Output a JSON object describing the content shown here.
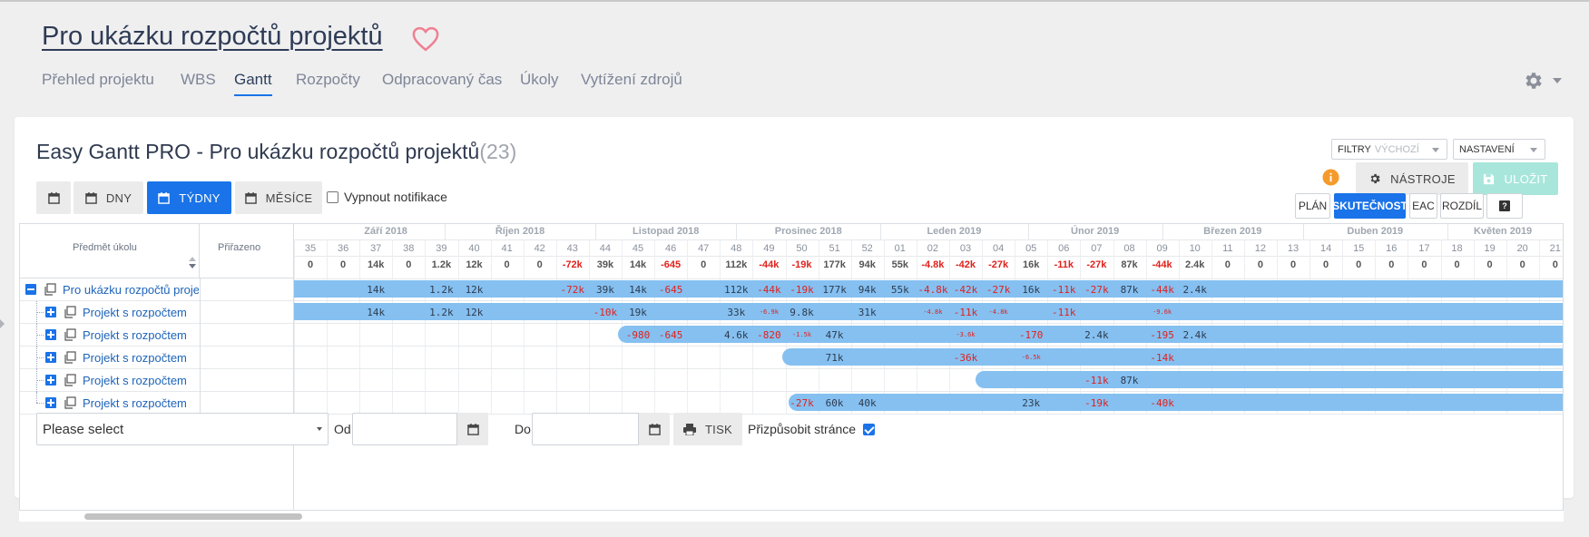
{
  "header": {
    "project_title": "Pro ukázku rozpočtů projektů",
    "tabs": [
      {
        "label": "Přehled projektu"
      },
      {
        "label": "WBS"
      },
      {
        "label": "Gantt"
      },
      {
        "label": "Rozpočty"
      },
      {
        "label": "Odpracovaný čas"
      },
      {
        "label": "Úkoly"
      },
      {
        "label": "Vytížení zdrojů"
      }
    ],
    "active_tab": "Gantt"
  },
  "gantt": {
    "title": "Easy Gantt PRO - Pro ukázku rozpočtů projektů",
    "count": "(23)",
    "filters": {
      "label": "FILTRY",
      "value": "VÝCHOZÍ"
    },
    "settings_label": "NASTAVENÍ",
    "zoom_buttons": {
      "days": "DNY",
      "weeks": "TÝDNY",
      "months": "MĚSÍCE",
      "active": "TÝDNY"
    },
    "notifications_label": "Vypnout notifikace",
    "notifications_checked": false,
    "tools_label": "NÁSTROJE",
    "save_label": "ULOŽIT",
    "modes": [
      "PLÁN",
      "SKUTEČNOST",
      "EAC",
      "ROZDÍL",
      "?"
    ],
    "active_mode": "SKUTEČNOST",
    "columns": {
      "subject": "Předmět úkolu",
      "assigned": "Přiřazeno"
    },
    "months": [
      {
        "label": "Září 2018"
      },
      {
        "label": "Říjen 2018"
      },
      {
        "label": "Listopad 2018"
      },
      {
        "label": "Prosinec 2018"
      },
      {
        "label": "Leden 2019"
      },
      {
        "label": "Únor 2019"
      },
      {
        "label": "Březen 2019"
      },
      {
        "label": "Duben 2019"
      },
      {
        "label": "Květen 2019"
      }
    ],
    "weeks": [
      "35",
      "36",
      "37",
      "38",
      "39",
      "40",
      "41",
      "42",
      "43",
      "44",
      "45",
      "46",
      "47",
      "48",
      "49",
      "50",
      "51",
      "52",
      "01",
      "02",
      "03",
      "04",
      "05",
      "06",
      "07",
      "08",
      "09",
      "10",
      "11",
      "12",
      "13",
      "14",
      "15",
      "16",
      "17",
      "18",
      "19",
      "20",
      "21"
    ],
    "totals": [
      "0",
      "0",
      "14k",
      "0",
      "1.2k",
      "12k",
      "0",
      "0",
      "-72k",
      "39k",
      "14k",
      "-645",
      "0",
      "112k",
      "-44k",
      "-19k",
      "177k",
      "94k",
      "55k",
      "-4.8k",
      "-42k",
      "-27k",
      "16k",
      "-11k",
      "-27k",
      "87k",
      "-44k",
      "2.4k",
      "0",
      "0",
      "0",
      "0",
      "0",
      "0",
      "0",
      "0",
      "0",
      "0",
      "0"
    ],
    "rows": [
      {
        "name": "Pro ukázku rozpočtů projektů",
        "level": 0,
        "expanded": true,
        "bar_start_week": 0,
        "values": {
          "2": "14k",
          "4": "1.2k",
          "5": "12k",
          "8": "-72k",
          "9": "39k",
          "10": "14k",
          "11": "-645",
          "13": "112k",
          "14": "-44k",
          "15": "-19k",
          "16": "177k",
          "17": "94k",
          "18": "55k",
          "19": "-4.8k",
          "20": "-42k",
          "21": "-27k",
          "22": "16k",
          "23": "-11k",
          "24": "-27k",
          "25": "87k",
          "26": "-44k",
          "27": "2.4k"
        }
      },
      {
        "name": "Projekt s rozpočtem",
        "level": 1,
        "expanded": false,
        "bar_start_week": 0,
        "values": {
          "2": "14k",
          "4": "1.2k",
          "5": "12k",
          "9": "-10k",
          "10": "19k",
          "13": "33k",
          "14": "-6.9k",
          "15": "9.8k",
          "17": "31k",
          "19": "-4.8k",
          "20": "-11k",
          "21": "-4.8k",
          "23": "-11k",
          "26": "-9.6k"
        }
      },
      {
        "name": "Projekt s rozpočtem",
        "level": 1,
        "expanded": false,
        "bar_start_week": 9.9,
        "values": {
          "10": "-980",
          "11": "-645",
          "13": "4.6k",
          "14": "-820",
          "15": "-1.5k",
          "16": "47k",
          "20": "-3.6k",
          "22": "-170",
          "24": "2.4k",
          "26": "-195",
          "27": "2.4k"
        }
      },
      {
        "name": "Projekt s rozpočtem",
        "level": 1,
        "expanded": false,
        "bar_start_week": 14.9,
        "values": {
          "16": "71k",
          "20": "-36k",
          "22": "-6.5k",
          "26": "-14k"
        }
      },
      {
        "name": "Projekt s rozpočtem",
        "level": 1,
        "expanded": false,
        "bar_start_week": 20.8,
        "values": {
          "24": "-11k",
          "25": "87k"
        }
      },
      {
        "name": "Projekt s rozpočtem",
        "level": 1,
        "expanded": false,
        "bar_start_week": 15.1,
        "values": {
          "15": "-27k",
          "16": "60k",
          "17": "40k",
          "22": "23k",
          "24": "-19k",
          "26": "-40k"
        }
      }
    ]
  },
  "footer": {
    "select_placeholder": "Please select",
    "from_label": "Od",
    "to_label": "Do",
    "from_value": "",
    "to_value": "",
    "print_label": "TISK",
    "fit_label": "Přizpůsobit stránce",
    "fit_checked": true
  },
  "colors": {
    "accent": "#1a73e8",
    "bar": "#85c0f1",
    "negative": "#e0211d",
    "save_button": "#a8e6dc",
    "info": "#f59b2b"
  }
}
